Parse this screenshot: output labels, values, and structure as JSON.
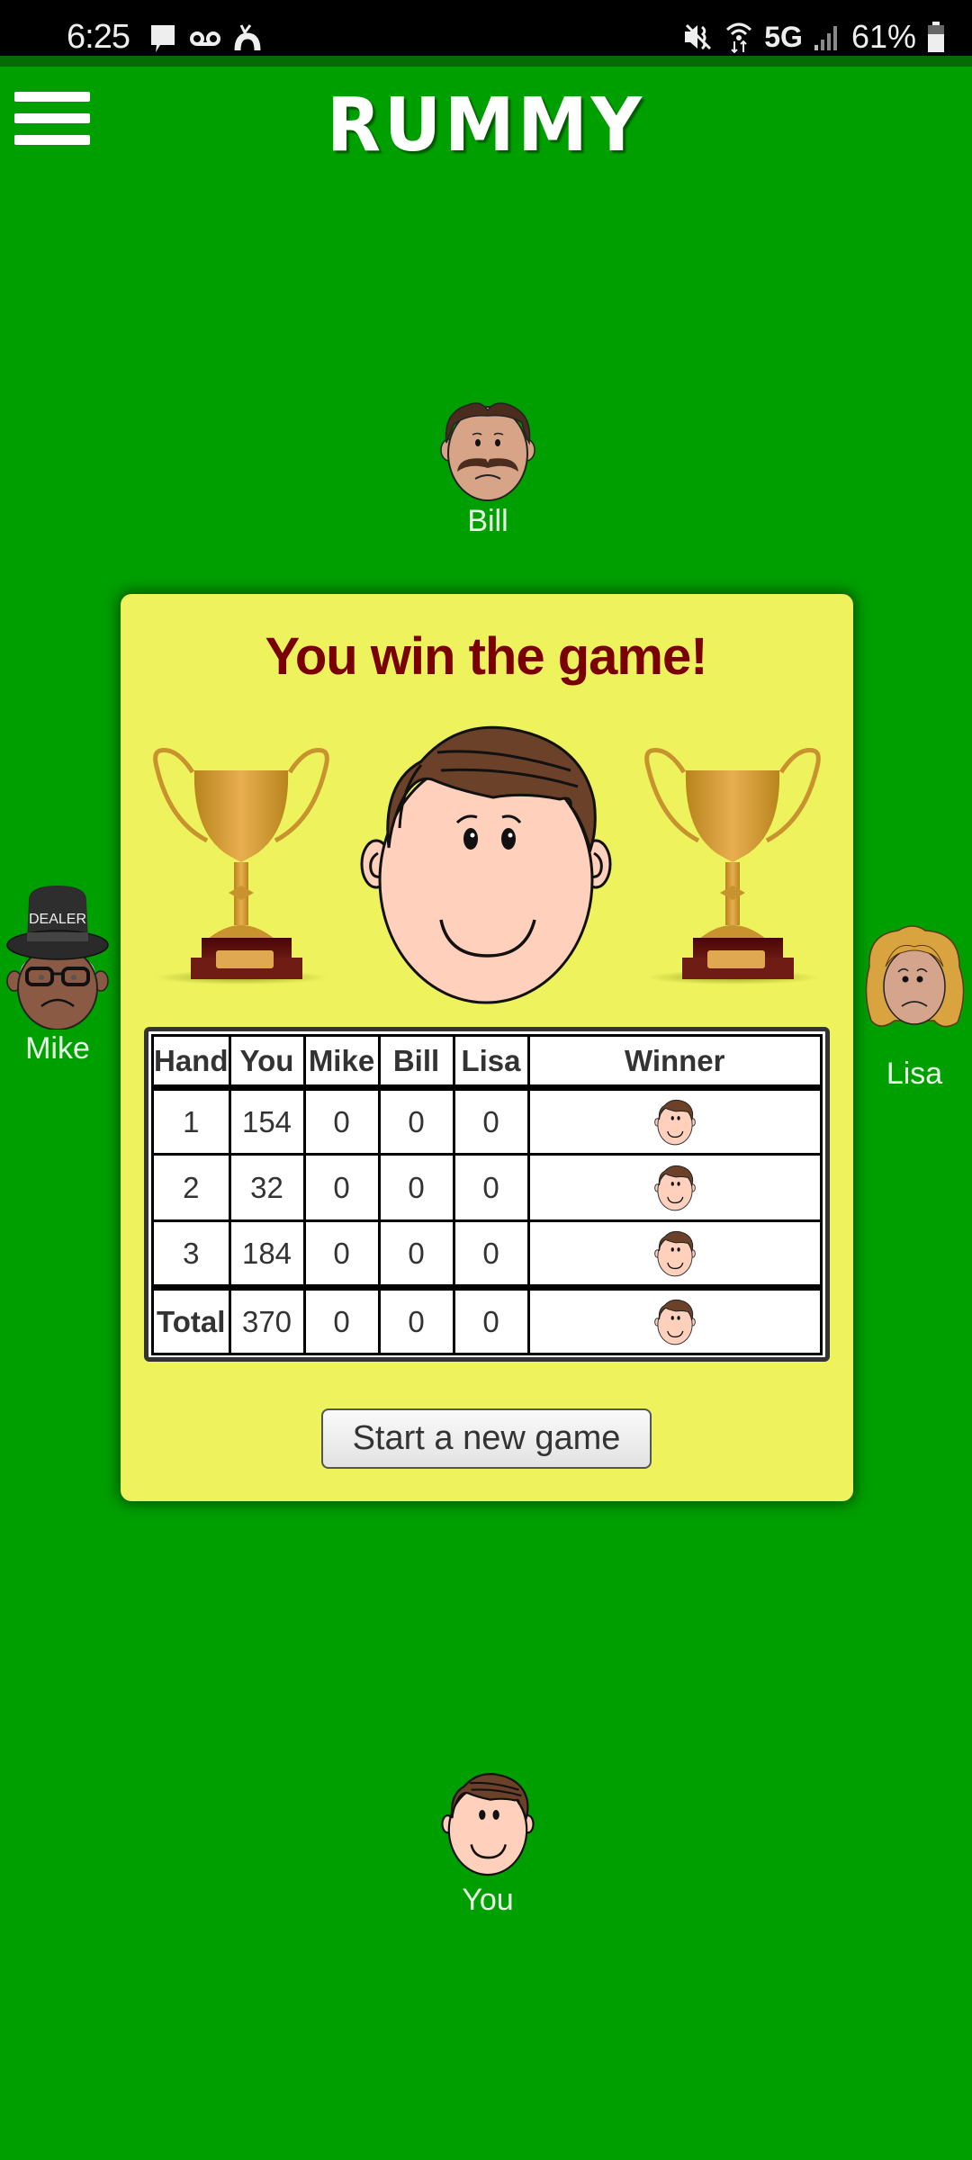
{
  "status_bar": {
    "time": "6:25",
    "left_icons": [
      "message-icon",
      "voicemail-icon",
      "missed-call-icon"
    ],
    "right_icons": [
      "vibrate-mute-icon",
      "wifi-icon",
      "signal-icon",
      "battery-icon"
    ],
    "network": "5G",
    "battery": "61%"
  },
  "header": {
    "menu_icon": "hamburger-menu-icon",
    "title": "RUMMY"
  },
  "players": {
    "top": {
      "name": "Bill",
      "mood": "sad"
    },
    "left": {
      "name": "Mike",
      "mood": "sad",
      "badge": "DEALER"
    },
    "right": {
      "name": "Lisa",
      "mood": "sad"
    },
    "bottom": {
      "name": "You",
      "mood": "happy"
    }
  },
  "result_dialog": {
    "title": "You win the game!",
    "new_game_label": "Start a new game",
    "colors": {
      "card_bg": "#EEF25C",
      "title": "#7A0000",
      "table_bg": "#FFFFFF"
    },
    "table": {
      "headers": [
        "Hand",
        "You",
        "Mike",
        "Bill",
        "Lisa",
        "Winner"
      ],
      "rows": [
        {
          "hand": "1",
          "you": "154",
          "mike": "0",
          "bill": "0",
          "lisa": "0",
          "winner": "You"
        },
        {
          "hand": "2",
          "you": "32",
          "mike": "0",
          "bill": "0",
          "lisa": "0",
          "winner": "You"
        },
        {
          "hand": "3",
          "you": "184",
          "mike": "0",
          "bill": "0",
          "lisa": "0",
          "winner": "You"
        }
      ],
      "total": {
        "hand": "Total",
        "you": "370",
        "mike": "0",
        "bill": "0",
        "lisa": "0",
        "winner": "You"
      }
    }
  },
  "colors": {
    "table_felt": "#009F00",
    "status_bar": "#000000"
  }
}
